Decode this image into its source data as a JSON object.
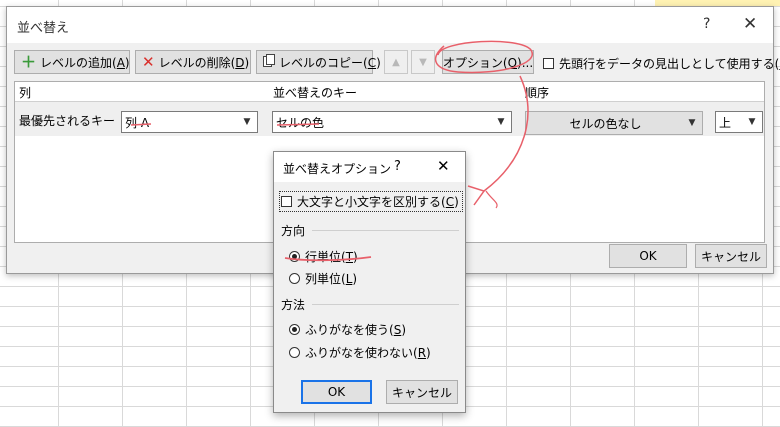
{
  "dialog": {
    "title": "並べ替え",
    "help": "?",
    "close": "✕",
    "toolbar": {
      "add_level": "レベルの追加(",
      "add_level_key": "A",
      "add_level_end": ")",
      "delete_level": "レベルの削除(",
      "delete_level_key": "D",
      "delete_level_end": ")",
      "copy_level": "レベルのコピー(",
      "copy_level_key": "C",
      "copy_level_end": ")",
      "options": "オプション(",
      "options_key": "O",
      "options_end": ")...",
      "header_checkbox": "先頭行をデータの見出しとして使用する(",
      "header_checkbox_key": "H",
      "header_checkbox_end": ")"
    },
    "columns": {
      "col": "列",
      "sort_on": "並べ替えのキー",
      "order": "順序"
    },
    "row": {
      "label": "最優先されるキー",
      "column_value": "列 A",
      "sort_on_value": "セルの色",
      "color_value": "セルの色なし",
      "position_value": "上"
    },
    "ok": "OK",
    "cancel": "キャンセル"
  },
  "options_dialog": {
    "title": "並べ替えオプション",
    "help": "?",
    "close": "✕",
    "case_sensitive": "大文字と小文字を区別する(",
    "case_sensitive_key": "C",
    "case_sensitive_end": ")",
    "orientation_label": "方向",
    "by_rows": "行単位(",
    "by_rows_key": "T",
    "by_rows_end": ")",
    "by_columns": "列単位(",
    "by_columns_key": "L",
    "by_columns_end": ")",
    "method_label": "方法",
    "use_furigana": "ふりがなを使う(",
    "use_furigana_key": "S",
    "use_furigana_end": ")",
    "no_furigana": "ふりがなを使わない(",
    "no_furigana_key": "R",
    "no_furigana_end": ")",
    "ok": "OK",
    "cancel": "キャンセル"
  },
  "colors": {
    "annotation": "#e8606a",
    "focus": "#1a73e8"
  }
}
